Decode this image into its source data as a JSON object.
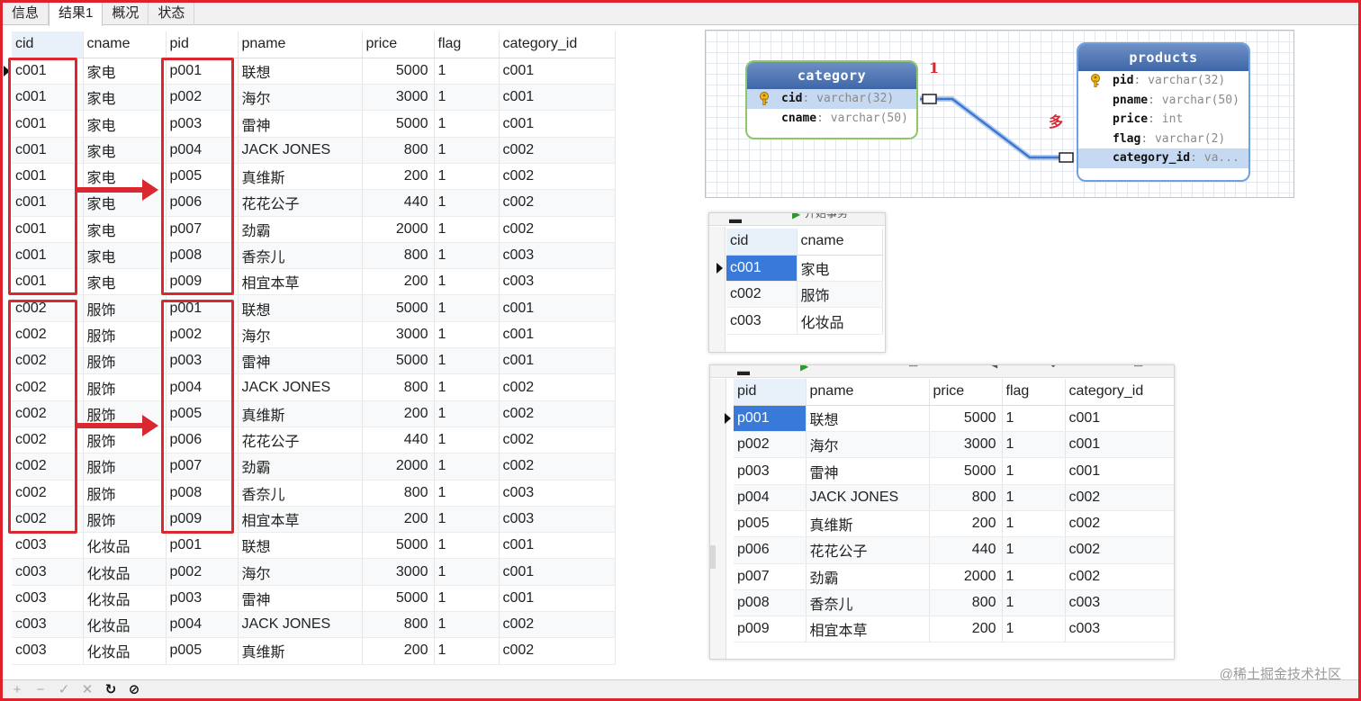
{
  "tabs": [
    "信息",
    "结果1",
    "概况",
    "状态"
  ],
  "active_tab": 1,
  "main_grid": {
    "columns": [
      "cid",
      "cname",
      "pid",
      "pname",
      "price",
      "flag",
      "category_id"
    ],
    "rows": [
      [
        "c001",
        "家电",
        "p001",
        "联想",
        "5000",
        "1",
        "c001"
      ],
      [
        "c001",
        "家电",
        "p002",
        "海尔",
        "3000",
        "1",
        "c001"
      ],
      [
        "c001",
        "家电",
        "p003",
        "雷神",
        "5000",
        "1",
        "c001"
      ],
      [
        "c001",
        "家电",
        "p004",
        "JACK JONES",
        "800",
        "1",
        "c002"
      ],
      [
        "c001",
        "家电",
        "p005",
        "真维斯",
        "200",
        "1",
        "c002"
      ],
      [
        "c001",
        "家电",
        "p006",
        "花花公子",
        "440",
        "1",
        "c002"
      ],
      [
        "c001",
        "家电",
        "p007",
        "劲霸",
        "2000",
        "1",
        "c002"
      ],
      [
        "c001",
        "家电",
        "p008",
        "香奈儿",
        "800",
        "1",
        "c003"
      ],
      [
        "c001",
        "家电",
        "p009",
        "相宜本草",
        "200",
        "1",
        "c003"
      ],
      [
        "c002",
        "服饰",
        "p001",
        "联想",
        "5000",
        "1",
        "c001"
      ],
      [
        "c002",
        "服饰",
        "p002",
        "海尔",
        "3000",
        "1",
        "c001"
      ],
      [
        "c002",
        "服饰",
        "p003",
        "雷神",
        "5000",
        "1",
        "c001"
      ],
      [
        "c002",
        "服饰",
        "p004",
        "JACK JONES",
        "800",
        "1",
        "c002"
      ],
      [
        "c002",
        "服饰",
        "p005",
        "真维斯",
        "200",
        "1",
        "c002"
      ],
      [
        "c002",
        "服饰",
        "p006",
        "花花公子",
        "440",
        "1",
        "c002"
      ],
      [
        "c002",
        "服饰",
        "p007",
        "劲霸",
        "2000",
        "1",
        "c002"
      ],
      [
        "c002",
        "服饰",
        "p008",
        "香奈儿",
        "800",
        "1",
        "c003"
      ],
      [
        "c002",
        "服饰",
        "p009",
        "相宜本草",
        "200",
        "1",
        "c003"
      ],
      [
        "c003",
        "化妆品",
        "p001",
        "联想",
        "5000",
        "1",
        "c001"
      ],
      [
        "c003",
        "化妆品",
        "p002",
        "海尔",
        "3000",
        "1",
        "c001"
      ],
      [
        "c003",
        "化妆品",
        "p003",
        "雷神",
        "5000",
        "1",
        "c001"
      ],
      [
        "c003",
        "化妆品",
        "p004",
        "JACK JONES",
        "800",
        "1",
        "c002"
      ],
      [
        "c003",
        "化妆品",
        "p005",
        "真维斯",
        "200",
        "1",
        "c002"
      ]
    ]
  },
  "er_diagram": {
    "category": {
      "title": "category",
      "fields": [
        {
          "name": "cid",
          "type": "varchar(32)",
          "key": true
        },
        {
          "name": "cname",
          "type": "varchar(50)",
          "key": false
        }
      ]
    },
    "products": {
      "title": "products",
      "fields": [
        {
          "name": "pid",
          "type": "varchar(32)",
          "key": true
        },
        {
          "name": "pname",
          "type": "varchar(50)",
          "key": false
        },
        {
          "name": "price",
          "type": "int",
          "key": false
        },
        {
          "name": "flag",
          "type": "varchar(2)",
          "key": false
        },
        {
          "name": "category_id",
          "type": "va...",
          "key": false
        }
      ]
    },
    "label_one": "1",
    "label_many": "多",
    "line_color": "#3a78d4"
  },
  "category_panel": {
    "toolbar_partial": "开始事务",
    "columns": [
      "cid",
      "cname"
    ],
    "rows": [
      [
        "c001",
        "家电"
      ],
      [
        "c002",
        "服饰"
      ],
      [
        "c003",
        "化妆品"
      ]
    ]
  },
  "products_panel": {
    "columns": [
      "pid",
      "pname",
      "price",
      "flag",
      "category_id"
    ],
    "rows": [
      [
        "p001",
        "联想",
        "5000",
        "1",
        "c001"
      ],
      [
        "p002",
        "海尔",
        "3000",
        "1",
        "c001"
      ],
      [
        "p003",
        "雷神",
        "5000",
        "1",
        "c001"
      ],
      [
        "p004",
        "JACK JONES",
        "800",
        "1",
        "c002"
      ],
      [
        "p005",
        "真维斯",
        "200",
        "1",
        "c002"
      ],
      [
        "p006",
        "花花公子",
        "440",
        "1",
        "c002"
      ],
      [
        "p007",
        "劲霸",
        "2000",
        "1",
        "c002"
      ],
      [
        "p008",
        "香奈儿",
        "800",
        "1",
        "c003"
      ],
      [
        "p009",
        "相宜本草",
        "200",
        "1",
        "c003"
      ]
    ]
  },
  "bottom_toolbar": [
    "add-icon",
    "delete-icon",
    "apply-icon",
    "discard-icon",
    "refresh-icon",
    "stop-icon"
  ],
  "watermark": "@稀土掘金技术社区",
  "colors": {
    "annotation_red": "#d9282f",
    "selection_blue": "#3879d9",
    "frame_red": "#e0202a"
  }
}
